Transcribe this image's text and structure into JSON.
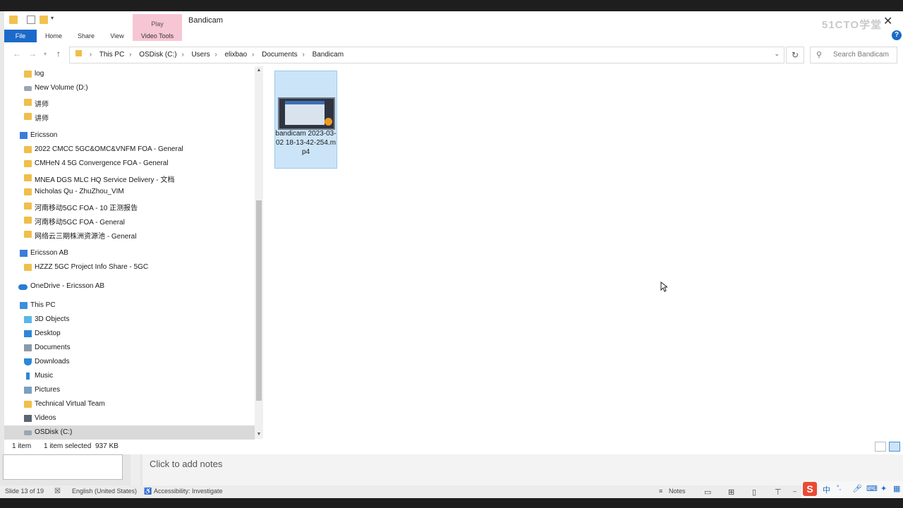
{
  "window": {
    "title": "Bandicam",
    "contextual_tab": "Play",
    "watermark": "51CTO学堂"
  },
  "ribbon": {
    "tabs": [
      "File",
      "Home",
      "Share",
      "View",
      "Video Tools"
    ]
  },
  "address": {
    "crumbs": [
      "This PC",
      "OSDisk (C:)",
      "Users",
      "elixbao",
      "Documents",
      "Bandicam"
    ],
    "search_placeholder": "Search Bandicam"
  },
  "nav": {
    "items": [
      {
        "label": "log",
        "icon": "folder-icon"
      },
      {
        "label": "New Volume (D:)",
        "icon": "drive-icon"
      },
      {
        "label": "讲师",
        "icon": "folder-icon"
      },
      {
        "label": "讲师",
        "icon": "folder-icon"
      },
      {
        "label": "Ericsson",
        "icon": "organization-icon"
      },
      {
        "label": "2022 CMCC 5GC&OMC&VNFM FOA - General",
        "icon": "folder-icon"
      },
      {
        "label": "CMHeN 4 5G Convergence FOA - General",
        "icon": "folder-icon"
      },
      {
        "label": "MNEA DGS MLC HQ Service Delivery - 文档",
        "icon": "folder-icon"
      },
      {
        "label": "Nicholas Qu - ZhuZhou_VIM",
        "icon": "folder-icon"
      },
      {
        "label": "河南移动5GC FOA - 10 正测报告",
        "icon": "folder-icon"
      },
      {
        "label": "河南移动5GC FOA - General",
        "icon": "folder-icon"
      },
      {
        "label": "网络云三期株洲资源池 - General",
        "icon": "folder-icon"
      },
      {
        "label": "Ericsson AB",
        "icon": "organization-icon"
      },
      {
        "label": "HZZZ 5GC Project Info Share - 5GC",
        "icon": "folder-icon"
      },
      {
        "label": "OneDrive - Ericsson AB",
        "icon": "cloud-icon"
      },
      {
        "label": "This PC",
        "icon": "computer-icon"
      },
      {
        "label": "3D Objects",
        "icon": "3d-objects-icon"
      },
      {
        "label": "Desktop",
        "icon": "desktop-icon"
      },
      {
        "label": "Documents",
        "icon": "documents-icon"
      },
      {
        "label": "Downloads",
        "icon": "downloads-icon"
      },
      {
        "label": "Music",
        "icon": "music-icon"
      },
      {
        "label": "Pictures",
        "icon": "pictures-icon"
      },
      {
        "label": "Technical Virtual Team",
        "icon": "folder-icon"
      },
      {
        "label": "Videos",
        "icon": "videos-icon"
      },
      {
        "label": "OSDisk (C:)",
        "icon": "drive-icon"
      }
    ]
  },
  "files": [
    {
      "name": "bandicam 2023-03-02 18-13-42-254.mp4",
      "icon": "video-file-icon",
      "selected": true
    }
  ],
  "status": {
    "count": "1 item",
    "selection": "1 item selected",
    "size": "937 KB"
  },
  "powerpoint": {
    "notes_placeholder": "Click to add notes",
    "slide_info": "Slide 13 of 19",
    "language": "English (United States)",
    "accessibility": "Accessibility: Investigate",
    "notes_button": "Notes",
    "ime": [
      "中",
      "°,"
    ]
  },
  "colors": {
    "accent": "#1b6ac9",
    "selection": "#cce4f7",
    "play_tab": "#f7c6d5"
  }
}
